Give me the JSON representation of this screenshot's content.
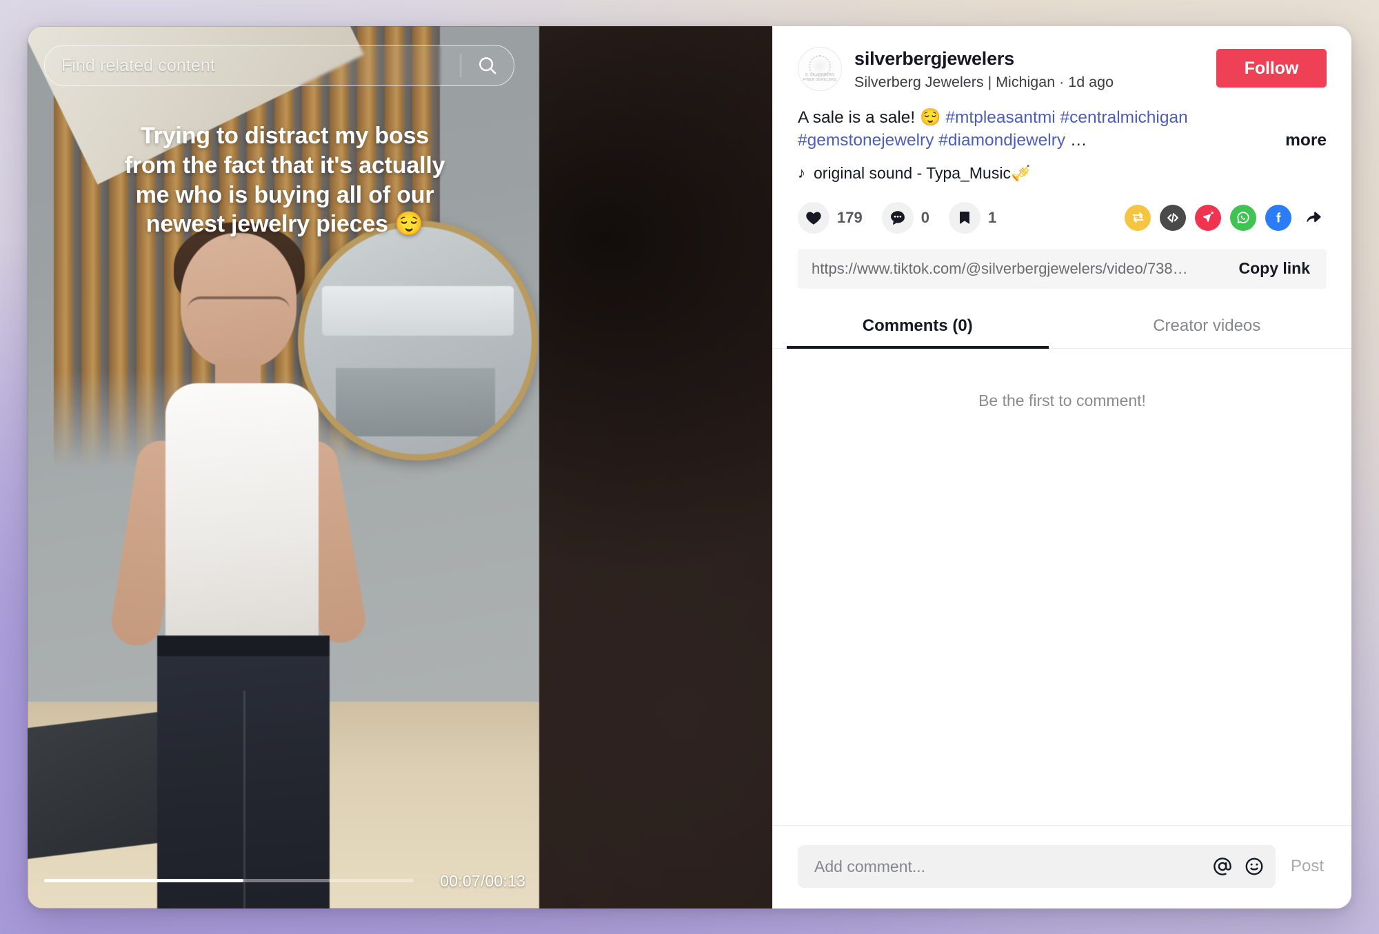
{
  "video": {
    "search_placeholder": "Find related content",
    "search_icon": "search-icon",
    "caption_overlay": "Trying to distract my boss\nfrom the fact that it's actually\nme who is buying all of our\nnewest jewelry pieces 😌",
    "time_display": "00:07/00:13",
    "progress_percent": 54
  },
  "author": {
    "handle": "silverbergjewelers",
    "subtitle": "Silverberg Jewelers | Michigan · 1d ago",
    "avatar_logo_line1": "S. SILVERBERG",
    "avatar_logo_line2": "FINER JEWELERS",
    "follow_label": "Follow",
    "follow_color": "#ee4156"
  },
  "post": {
    "description_text": "A sale is a sale! 😌 ",
    "hashtags": [
      "#mtpleasantmi",
      "#centralmichigan",
      "#gemstonejewelry",
      "#diamondjewelry"
    ],
    "description_ellipsis": "…",
    "more_label": "more",
    "hashtag_color": "#4b5dbb",
    "music_icon": "music-note-icon",
    "music_label": "original sound - Typa_Music🎺"
  },
  "stats": [
    {
      "icon": "heart-icon",
      "name": "like",
      "count": "179"
    },
    {
      "icon": "comment-icon",
      "name": "comment",
      "count": "0"
    },
    {
      "icon": "bookmark-icon",
      "name": "bookmark",
      "count": "1"
    }
  ],
  "share_icons": [
    {
      "name": "repost-icon",
      "label": "Repost",
      "color": "#f5c542"
    },
    {
      "name": "embed-icon",
      "label": "Embed",
      "color": "#4a4a4a"
    },
    {
      "name": "send-icon",
      "label": "Send to friends",
      "color": "#f0334f"
    },
    {
      "name": "whatsapp-icon",
      "label": "WhatsApp",
      "color": "#3fc351"
    },
    {
      "name": "facebook-icon",
      "label": "Facebook",
      "color": "#2a7cf7"
    },
    {
      "name": "share-arrow-icon",
      "label": "Share",
      "color": "#161823"
    }
  ],
  "copy_link": {
    "url": "https://www.tiktok.com/@silverbergjewelers/video/738…",
    "button_label": "Copy link"
  },
  "tabs": [
    {
      "label": "Comments (0)",
      "active": true
    },
    {
      "label": "Creator videos",
      "active": false
    }
  ],
  "comments": {
    "empty_message": "Be the first to comment!"
  },
  "composer": {
    "placeholder": "Add comment...",
    "mention_icon": "at-mention-icon",
    "emoji_icon": "emoji-icon",
    "post_label": "Post"
  }
}
